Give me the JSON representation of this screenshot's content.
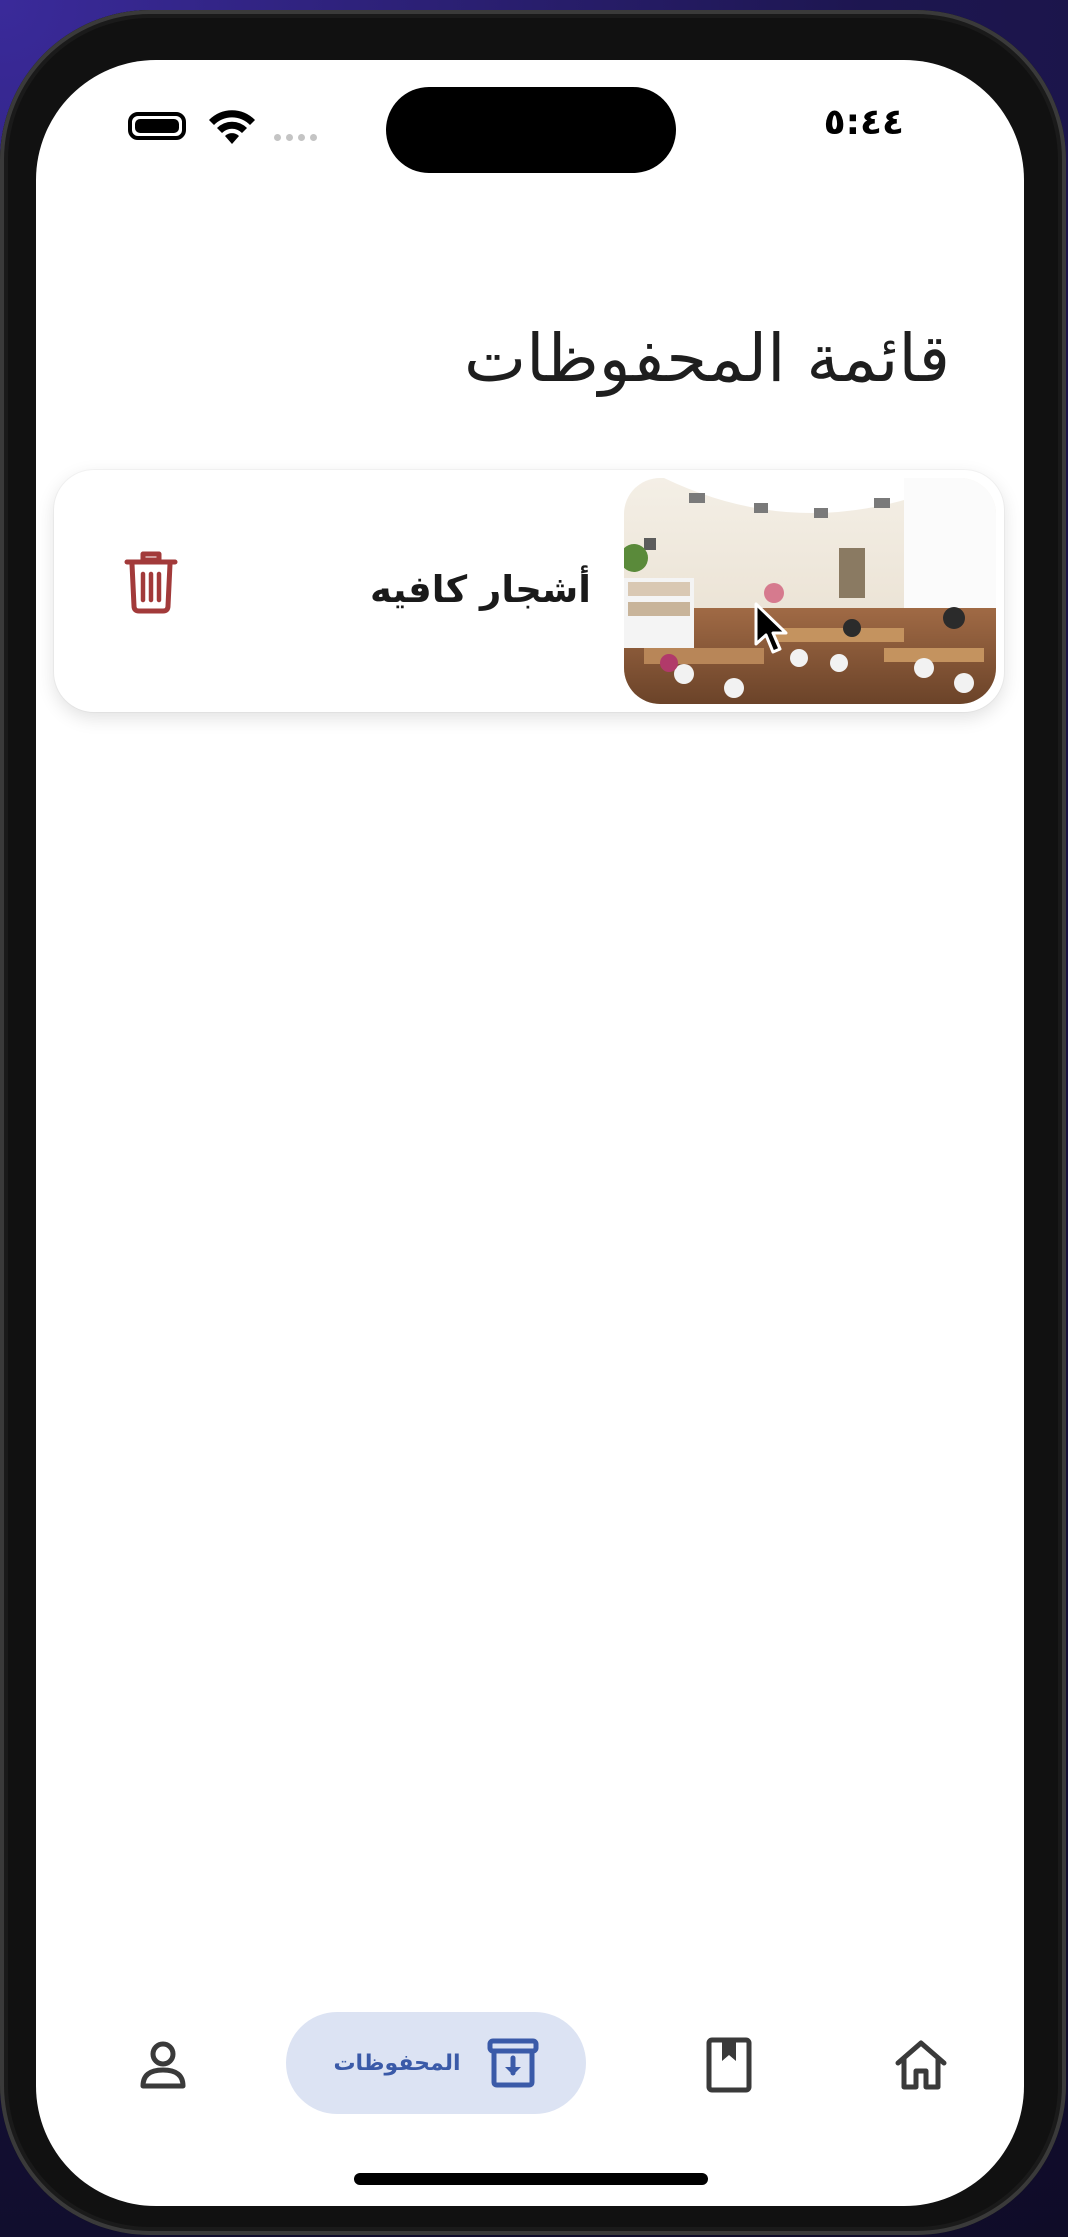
{
  "status_bar": {
    "time": "٥:٤٤"
  },
  "page": {
    "title": "قائمة المحفوظات"
  },
  "saved_items": [
    {
      "name": "أشجار كافيه",
      "image": "cafe-interior-photo",
      "action_icon": "trash-icon",
      "action_color": "#a23a3a"
    }
  ],
  "bottom_nav": {
    "items": [
      {
        "icon": "home-icon",
        "label": "",
        "active": false
      },
      {
        "icon": "bookmark-icon",
        "label": "",
        "active": false
      },
      {
        "icon": "archive-download-icon",
        "label": "المحفوظات",
        "active": true
      },
      {
        "icon": "user-icon",
        "label": "",
        "active": false
      }
    ],
    "active_bg": "#dce3f3",
    "active_color": "#3a5aa8"
  }
}
